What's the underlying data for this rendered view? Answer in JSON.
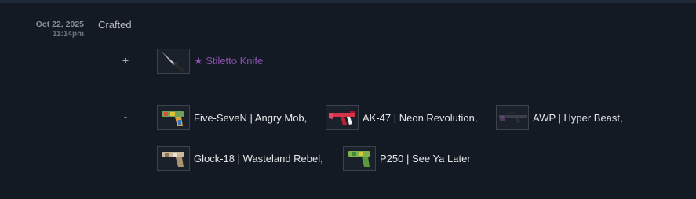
{
  "history": {
    "date": "Oct 22, 2025",
    "time": "11:14pm",
    "event": "Crafted",
    "received_sign": "+",
    "lost_sign": "-",
    "received": [
      {
        "name": "★ Stiletto Knife",
        "icon": "stiletto-knife-icon",
        "color": "#8650ac"
      }
    ],
    "lost": [
      {
        "name": "Five-SeveN | Angry Mob",
        "suffix": ",",
        "icon": "five-seven-icon"
      },
      {
        "name": "AK-47 | Neon Revolution",
        "suffix": ",",
        "icon": "ak47-icon"
      },
      {
        "name": "AWP | Hyper Beast",
        "suffix": ",",
        "icon": "awp-icon"
      },
      {
        "name": "Glock-18 | Wasteland Rebel",
        "suffix": ",",
        "icon": "glock-icon"
      },
      {
        "name": "P250 | See Ya Later",
        "suffix": "",
        "icon": "p250-icon"
      }
    ]
  }
}
